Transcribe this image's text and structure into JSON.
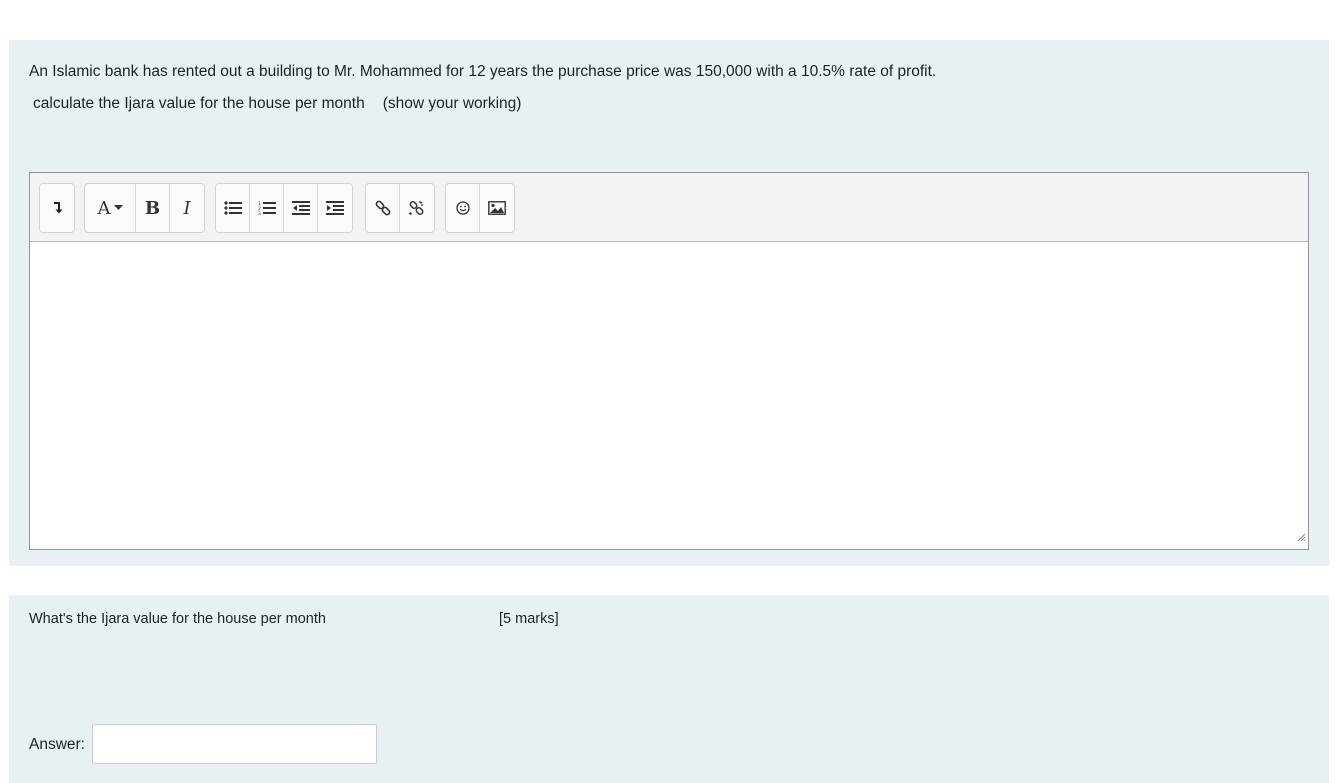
{
  "question1": {
    "text_line1": "An Islamic bank has rented out a building to Mr. Mohammed for 12 years the purchase price was 150,000 with a 10.5% rate of profit.",
    "text_line2a": "calculate the Ijara value for the house per month",
    "text_line2b": "(show your working)"
  },
  "editor": {
    "toolbar_buttons": [
      {
        "name": "show-more-buttons",
        "icon": "down-arrow-icon"
      },
      {
        "name": "paragraph-style",
        "label": "A"
      },
      {
        "name": "bold",
        "label": "B"
      },
      {
        "name": "italic",
        "label": "I"
      },
      {
        "name": "unordered-list",
        "icon": "bullet-list-icon"
      },
      {
        "name": "ordered-list",
        "icon": "numbered-list-icon"
      },
      {
        "name": "outdent",
        "icon": "outdent-icon"
      },
      {
        "name": "indent",
        "icon": "indent-icon"
      },
      {
        "name": "link",
        "icon": "link-icon"
      },
      {
        "name": "unlink",
        "icon": "unlink-icon"
      },
      {
        "name": "emoji",
        "icon": "smiley-icon"
      },
      {
        "name": "image",
        "icon": "image-icon"
      }
    ],
    "content": ""
  },
  "question2": {
    "prompt": "What's the Ijara value for the house per month",
    "marks": "[5 marks]",
    "answer_label": "Answer:",
    "answer_value": ""
  }
}
